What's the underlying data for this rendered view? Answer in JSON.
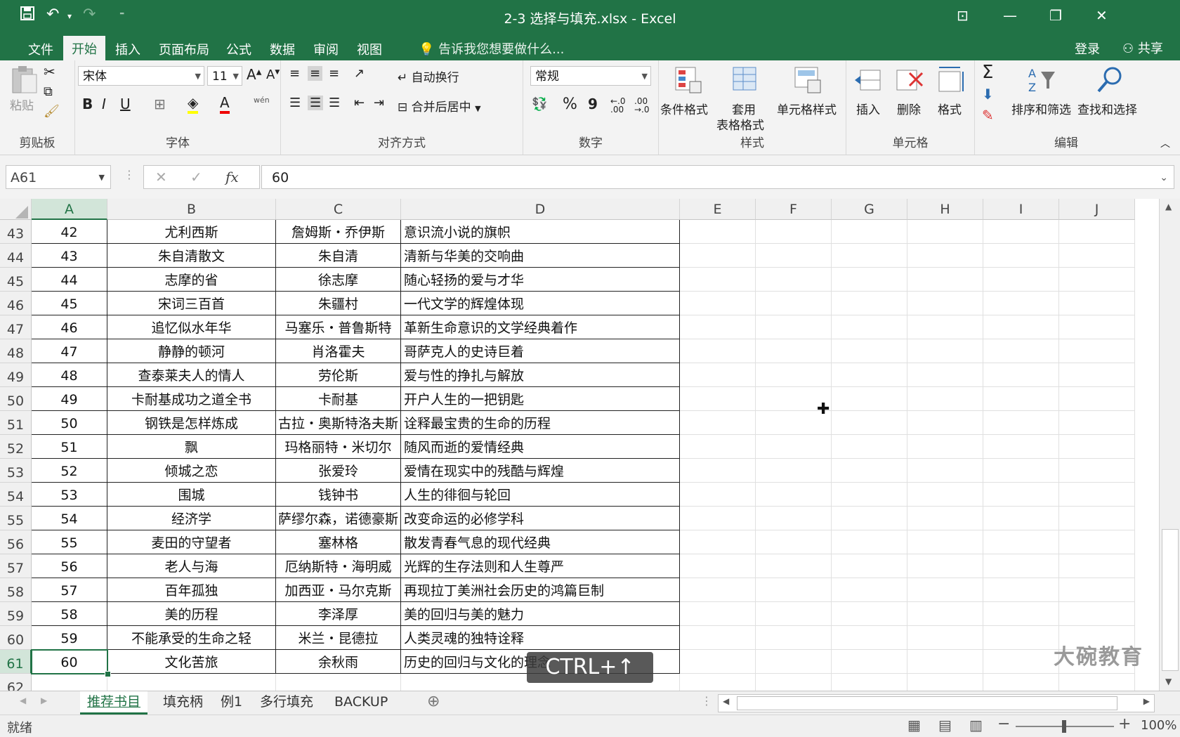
{
  "window": {
    "title": "2-3 选择与填充.xlsx - Excel"
  },
  "tabs": [
    "文件",
    "开始",
    "插入",
    "页面布局",
    "公式",
    "数据",
    "审阅",
    "视图"
  ],
  "tell_me": "告诉我您想要做什么...",
  "account": {
    "login": "登录",
    "share": "共享"
  },
  "ribbon": {
    "clipboard": {
      "paste": "粘贴",
      "group": "剪贴板"
    },
    "font": {
      "name": "宋体",
      "size": "11",
      "bold": "B",
      "italic": "I",
      "underline": "U",
      "phonetic": "wén",
      "group": "字体"
    },
    "alignment": {
      "wrap": "自动换行",
      "merge": "合并后居中",
      "group": "对齐方式"
    },
    "number": {
      "format": "常规",
      "percent": "%",
      "comma": "9",
      "group": "数字"
    },
    "styles": {
      "conditional": "条件格式",
      "table_1": "套用",
      "table_2": "表格格式",
      "cell_styles": "单元格样式",
      "group": "样式"
    },
    "cells": {
      "insert": "插入",
      "delete": "删除",
      "format": "格式",
      "group": "单元格"
    },
    "editing": {
      "sigma": "Σ",
      "sort": "排序和筛选",
      "find": "查找和选择",
      "group": "编辑"
    }
  },
  "formula_bar": {
    "name_box": "A61",
    "fx": "fx",
    "value": "60"
  },
  "columns": [
    "A",
    "B",
    "C",
    "D",
    "E",
    "F",
    "G",
    "H",
    "I",
    "J"
  ],
  "rows": [
    {
      "num": "43",
      "a": "42",
      "b": "尤利西斯",
      "c": "詹姆斯・乔伊斯",
      "d": "意识流小说的旗帜"
    },
    {
      "num": "44",
      "a": "43",
      "b": "朱自清散文",
      "c": "朱自清",
      "d": "清新与华美的交响曲"
    },
    {
      "num": "45",
      "a": "44",
      "b": "志摩的省",
      "c": "徐志摩",
      "d": "随心轻扬的爱与才华"
    },
    {
      "num": "46",
      "a": "45",
      "b": "宋词三百首",
      "c": "朱疆村",
      "d": "一代文学的辉煌体现"
    },
    {
      "num": "47",
      "a": "46",
      "b": "追忆似水年华",
      "c": "马塞乐・普鲁斯特",
      "d": "革新生命意识的文学经典着作"
    },
    {
      "num": "48",
      "a": "47",
      "b": "静静的顿河",
      "c": "肖洛霍夫",
      "d": "哥萨克人的史诗巨着"
    },
    {
      "num": "49",
      "a": "48",
      "b": "查泰莱夫人的情人",
      "c": "劳伦斯",
      "d": "爱与性的挣扎与解放"
    },
    {
      "num": "50",
      "a": "49",
      "b": "卡耐基成功之道全书",
      "c": "卡耐基",
      "d": "开户人生的一把钥匙"
    },
    {
      "num": "51",
      "a": "50",
      "b": "钢铁是怎样炼成",
      "c": "古拉・奥斯特洛夫斯",
      "d": "诠释最宝贵的生命的历程"
    },
    {
      "num": "52",
      "a": "51",
      "b": "飘",
      "c": "玛格丽特・米切尔",
      "d": "随风而逝的爱情经典"
    },
    {
      "num": "53",
      "a": "52",
      "b": "倾城之恋",
      "c": "张爱玲",
      "d": "爱情在现实中的残酷与辉煌"
    },
    {
      "num": "54",
      "a": "53",
      "b": "围城",
      "c": "钱钟书",
      "d": "人生的徘徊与轮回"
    },
    {
      "num": "55",
      "a": "54",
      "b": "经济学",
      "c": "萨缪尔森，诺德豪斯",
      "d": "改变命运的必修学科"
    },
    {
      "num": "56",
      "a": "55",
      "b": "麦田的守望者",
      "c": "塞林格",
      "d": "散发青春气息的现代经典"
    },
    {
      "num": "57",
      "a": "56",
      "b": "老人与海",
      "c": "厄纳斯特・海明威",
      "d": "光辉的生存法则和人生尊严"
    },
    {
      "num": "58",
      "a": "57",
      "b": "百年孤独",
      "c": "加西亚・马尔克斯",
      "d": "再现拉丁美洲社会历史的鸿篇巨制"
    },
    {
      "num": "59",
      "a": "58",
      "b": "美的历程",
      "c": "李泽厚",
      "d": "美的回归与美的魅力"
    },
    {
      "num": "60",
      "a": "59",
      "b": "不能承受的生命之轻",
      "c": "米兰・昆德拉",
      "d": "人类灵魂的独特诠释"
    },
    {
      "num": "61",
      "a": "60",
      "b": "文化苦旅",
      "c": "余秋雨",
      "d": "历史的回归与文化的理念"
    },
    {
      "num": "62",
      "a": "",
      "b": "",
      "c": "",
      "d": ""
    }
  ],
  "sheets": [
    "推荐书目",
    "填充柄",
    "例1",
    "多行填充",
    "BACKUP"
  ],
  "status": {
    "ready": "就绪",
    "zoom": "100%"
  },
  "overlay": {
    "key_hint": "CTRL+↑",
    "watermark": "大碗教育"
  },
  "colors": {
    "excel_green": "#217346",
    "ribbon_bg": "#f3f3f3"
  }
}
